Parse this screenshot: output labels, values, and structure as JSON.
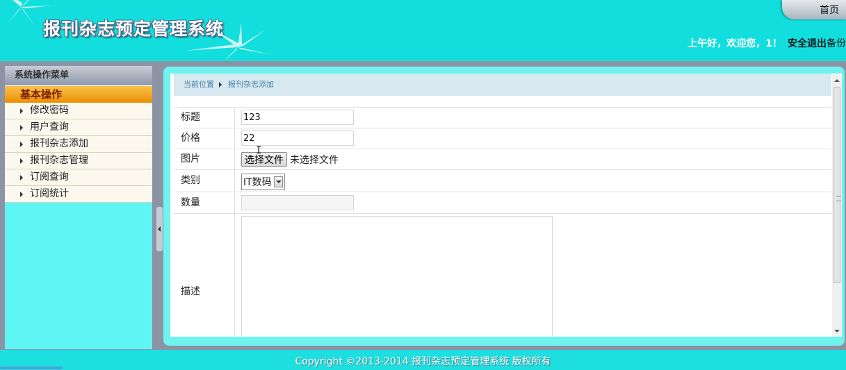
{
  "header": {
    "app_title": "报刊杂志预定管理系统",
    "home_label": "首页",
    "greeting": "上午好，欢迎您，1！",
    "logout_label": "安全退出",
    "backup_label": "备份"
  },
  "sidebar": {
    "header": "系统操作菜单",
    "group": "基本操作",
    "items": [
      {
        "label": "修改密码"
      },
      {
        "label": "用户查询"
      },
      {
        "label": "报刊杂志添加"
      },
      {
        "label": "报刊杂志管理"
      },
      {
        "label": "订阅查询"
      },
      {
        "label": "订阅统计"
      }
    ]
  },
  "breadcrumb": {
    "current_label": "当前位置",
    "page": "报刊杂志添加"
  },
  "form": {
    "title_label": "标题",
    "title_value": "123",
    "price_label": "价格",
    "price_value": "22",
    "image_label": "图片",
    "file_button": "选择文件",
    "file_status": "未选择文件",
    "category_label": "类别",
    "category_value": "IT数码",
    "quantity_label": "数量",
    "quantity_value": "",
    "description_label": "描述",
    "description_value": ""
  },
  "footer": {
    "copyright": "Copyright ©2013-2014 报刊杂志预定管理系统 版权所有"
  }
}
